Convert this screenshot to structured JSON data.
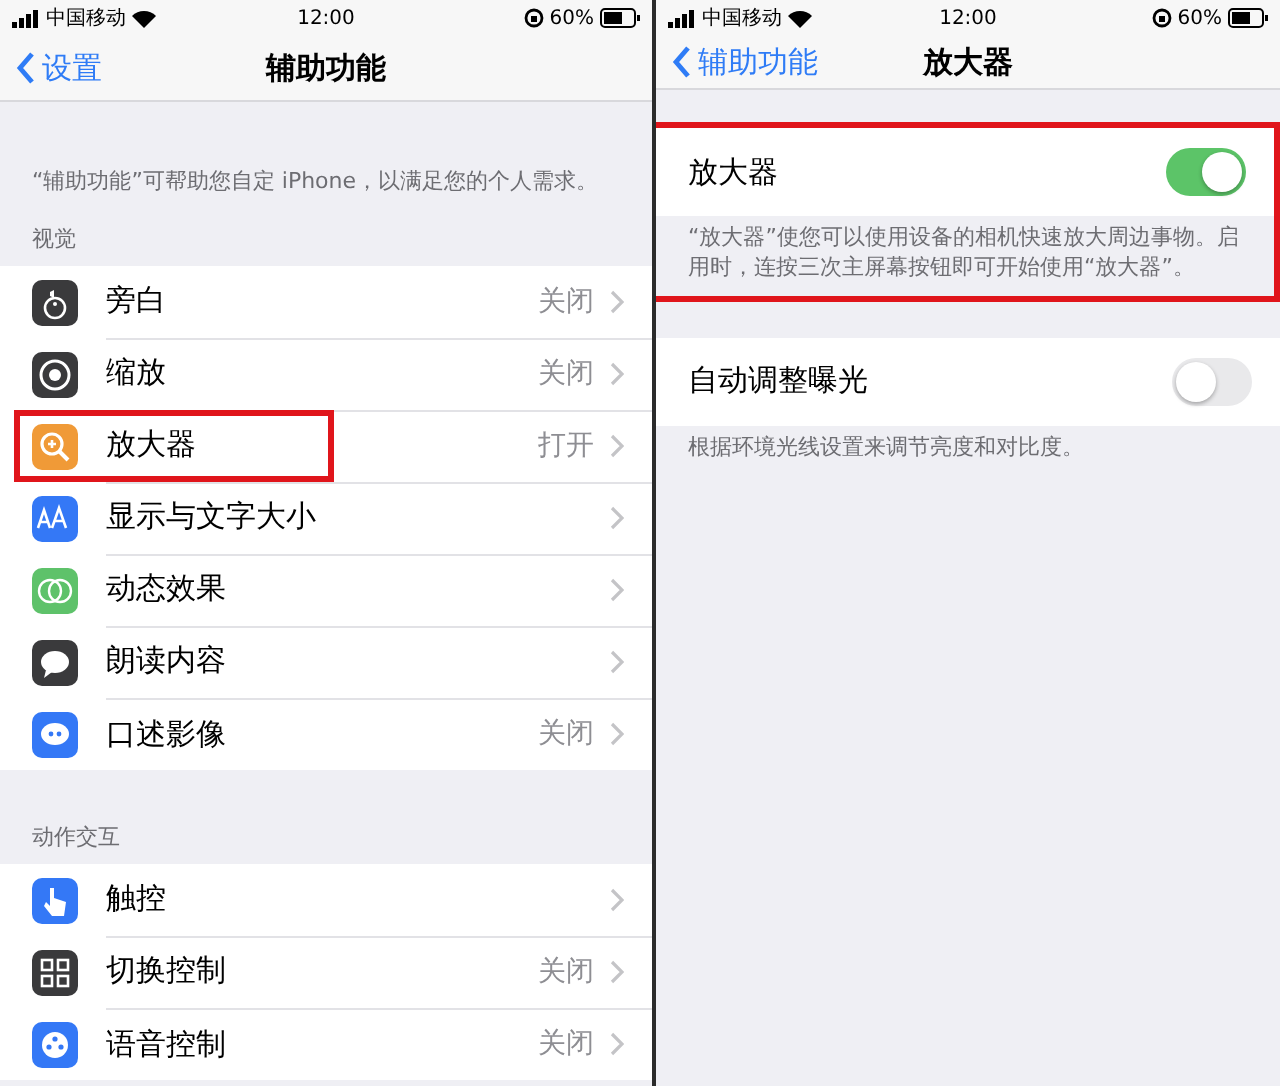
{
  "left": {
    "status_bar": {
      "carrier": "中国移动",
      "time": "12:00",
      "battery": "60%"
    },
    "nav": {
      "back": "设置",
      "title": "辅助功能"
    },
    "intro": "“辅助功能”可帮助您自定 iPhone，以满足您的个人需求。",
    "sections": [
      {
        "header": "视觉",
        "items": [
          {
            "label": "旁白",
            "value": "关闭",
            "highlighted": false
          },
          {
            "label": "缩放",
            "value": "关闭",
            "highlighted": false
          },
          {
            "label": "放大器",
            "value": "打开",
            "highlighted": true
          },
          {
            "label": "显示与文字大小",
            "highlighted": false
          },
          {
            "label": "动态效果",
            "highlighted": false
          },
          {
            "label": "朗读内容",
            "highlighted": false
          },
          {
            "label": "口述影像",
            "value": "关闭",
            "highlighted": false
          }
        ]
      },
      {
        "header": "动作交互",
        "items": [
          {
            "label": "触控",
            "highlighted": false
          },
          {
            "label": "切换控制",
            "value": "关闭",
            "highlighted": false
          },
          {
            "label": "语音控制",
            "value": "关闭",
            "highlighted": false
          }
        ]
      }
    ]
  },
  "right": {
    "status_bar": {
      "carrier": "中国移动",
      "time": "12:00",
      "battery": "60%"
    },
    "nav": {
      "back": "辅助功能",
      "title": "放大器"
    },
    "groups": [
      {
        "label": "放大器",
        "on": true,
        "footer": "“放大器”使您可以使用设备的相机快速放大周边事物。启用时，连按三次主屏幕按钮即可开始使用“放大器”。",
        "highlighted": true
      },
      {
        "label": "自动调整曝光",
        "on": false,
        "footer": "根据环境光线设置来调节亮度和对比度。",
        "highlighted": false
      }
    ]
  }
}
